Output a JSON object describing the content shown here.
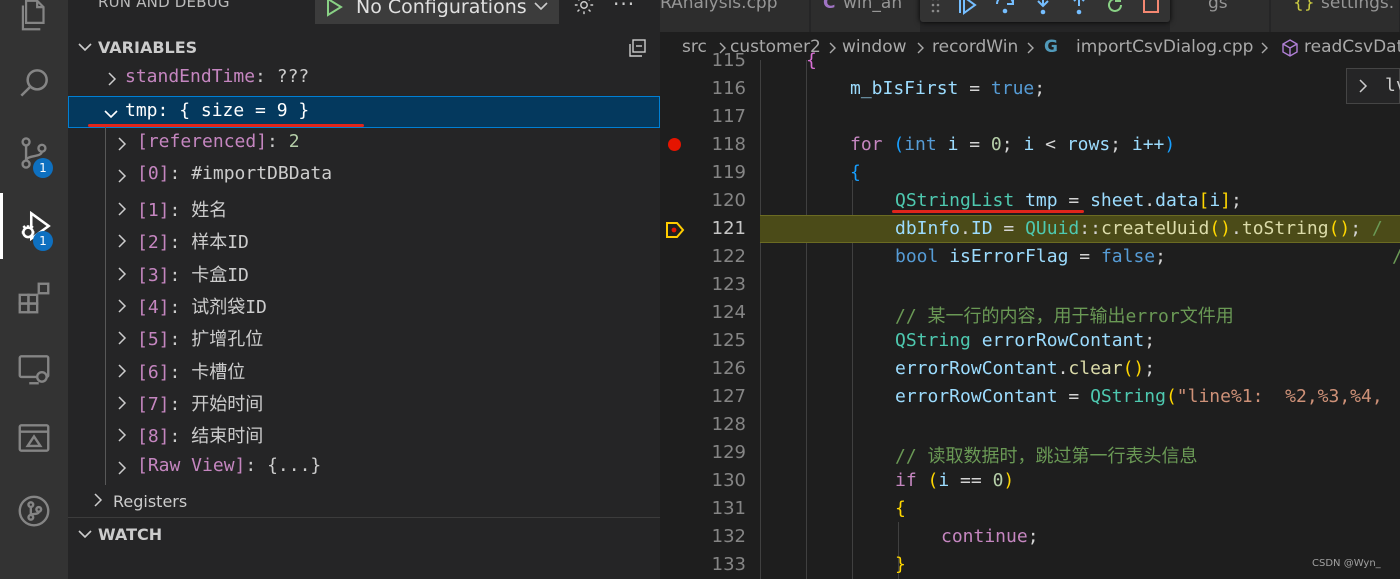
{
  "activity_bar": {
    "items": [
      {
        "name": "explorer-icon"
      },
      {
        "name": "search-icon"
      },
      {
        "name": "source-control-icon",
        "badge": "1"
      },
      {
        "name": "run-debug-icon",
        "badge": "1",
        "active": true
      },
      {
        "name": "extensions-icon"
      },
      {
        "name": "remote-explorer-icon"
      },
      {
        "name": "testing-icon"
      },
      {
        "name": "git-graph-icon"
      }
    ]
  },
  "debug_header": {
    "title": "RUN AND DEBUG",
    "config": "No Configurations",
    "play_icon": "play-icon",
    "settings_icon": "gear-icon",
    "more_icon": "ellipsis-icon"
  },
  "variables": {
    "title": "VARIABLES",
    "collapse_icon": "collapse-all-icon",
    "rows": [
      {
        "name": "standEndTime",
        "value": "???"
      },
      {
        "name": "tmp",
        "value": "{ size = 9 }"
      },
      {
        "name": "[referenced]",
        "value": "2"
      },
      {
        "name": "[0]",
        "value": "#importDBData"
      },
      {
        "name": "[1]",
        "value": "姓名"
      },
      {
        "name": "[2]",
        "value": "样本ID"
      },
      {
        "name": "[3]",
        "value": "卡盒ID"
      },
      {
        "name": "[4]",
        "value": "试剂袋ID"
      },
      {
        "name": "[5]",
        "value": "扩增孔位"
      },
      {
        "name": "[6]",
        "value": "卡槽位"
      },
      {
        "name": "[7]",
        "value": "开始时间"
      },
      {
        "name": "[8]",
        "value": "结束时间"
      },
      {
        "name": "[Raw View]",
        "value": "{...}"
      }
    ],
    "separator": ": "
  },
  "registers": {
    "title": "Registers"
  },
  "watch": {
    "title": "WATCH"
  },
  "tabs": [
    {
      "label": "RAnalysis.cpp"
    },
    {
      "label": "win_an"
    },
    {
      "label": "gs"
    },
    {
      "label": "settings."
    }
  ],
  "debug_toolbar": {
    "icons": [
      "continue-icon",
      "step-over-icon",
      "step-into-icon",
      "step-out-icon",
      "restart-icon",
      "stop-icon"
    ]
  },
  "breadcrumb": {
    "items": [
      "src",
      "customer2",
      "window",
      "recordWin",
      "importCsvDialog.cpp",
      "readCsvDat"
    ]
  },
  "editor": {
    "current_line": 121,
    "breakpoint_line": 118,
    "line_numbers": [
      "115",
      "116",
      "117",
      "118",
      "119",
      "120",
      "121",
      "122",
      "123",
      "124",
      "125",
      "126",
      "127",
      "128",
      "129",
      "130",
      "131",
      "132",
      "133"
    ]
  },
  "code": {
    "l115": "{",
    "l116_var": "m_bIsFirst",
    "l116_op": " = ",
    "l116_kw": "true",
    "l116_end": ";",
    "l118_for": "for",
    "l118_int": "int",
    "l118_i": "i",
    "l118_op1": " = ",
    "l118_zero": "0",
    "l118_semi": "; ",
    "l118_i2": "i",
    "l118_lt": " < ",
    "l118_rows": "rows",
    "l118_semi2": "; ",
    "l118_inc": "i++",
    "l119": "{",
    "l120_type": "QStringList",
    "l120_var": "tmp",
    "l120_op": " = ",
    "l120_sheet": "sheet",
    "l120_dot": ".",
    "l120_data": "data",
    "l120_i": "i",
    "l120_end": ";",
    "l121_obj": "dbInfo",
    "l121_dot": ".",
    "l121_field": "ID",
    "l121_op": " = ",
    "l121_type": "QUuid",
    "l121_scope": "::",
    "l121_fn": "createUuid",
    "l121_dot2": ".",
    "l121_fn2": "toString",
    "l121_end": ";",
    "l121_cm": " /",
    "l122_kw": "bool",
    "l122_var": "isErrorFlag",
    "l122_op": " = ",
    "l122_val": "false",
    "l122_end": ";",
    "l122_cm": "/",
    "l124_cm": "// 某一行的内容，用于输出error文件用",
    "l125_type": "QString",
    "l125_var": "errorRowContant",
    "l125_end": ";",
    "l126_var": "errorRowContant",
    "l126_dot": ".",
    "l126_fn": "clear",
    "l126_end": ";",
    "l127_var": "errorRowContant",
    "l127_op": " = ",
    "l127_fn": "QString",
    "l127_str": "\"line%1:  %2,%3,%4,",
    "l129_cm": "// 读取数据时，跳过第一行表头信息",
    "l130_if": "if",
    "l130_i": "i",
    "l130_eq": " == ",
    "l130_zero": "0",
    "l131": "{",
    "l132_kw": "continue",
    "l132_end": ";",
    "l133": "}"
  },
  "hover_widget": {
    "text": "lv"
  },
  "watermark": "CSDN @Wyn_"
}
